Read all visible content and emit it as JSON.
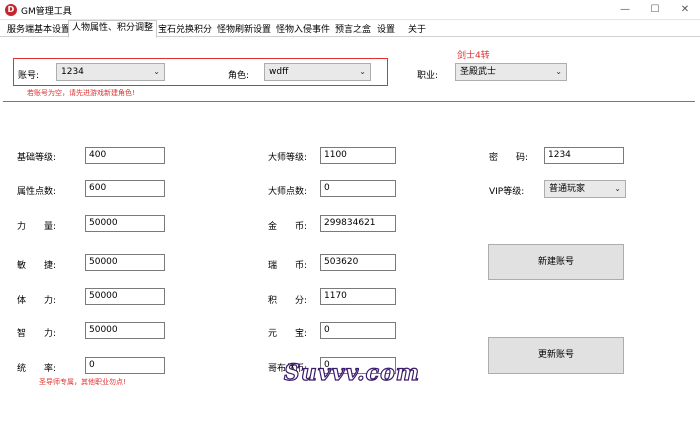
{
  "window": {
    "title": "GM管理工具",
    "icon_letter": "D",
    "minimize": "—",
    "maximize": "☐",
    "close": "✕"
  },
  "tabs": [
    "服务端基本设置",
    "人物属性、积分调整",
    "宝石兑换积分",
    "怪物刷新设置",
    "怪物入侵事件",
    "预言之盒",
    "设置",
    "关于"
  ],
  "account": {
    "label": "账号:",
    "value": "1234",
    "warning": "若账号为空，请先进游戏新建角色!",
    "role_label": "角色:",
    "role_value": "wdff",
    "job_label": "职业:",
    "job_value": "圣殿武士",
    "rank_text": "剑士4转"
  },
  "left": [
    {
      "label": "基础等级:",
      "value": "400"
    },
    {
      "label": "属性点数:",
      "value": "600"
    },
    {
      "label": "力　　量:",
      "value": "50000"
    },
    {
      "label": "敏　　捷:",
      "value": "50000"
    },
    {
      "label": "体　　力:",
      "value": "50000"
    },
    {
      "label": "智　　力:",
      "value": "50000"
    },
    {
      "label": "统　　率:",
      "value": "0"
    }
  ],
  "left_note": "圣导师专属，其他职业勿点!",
  "middle": [
    {
      "label": "大师等级:",
      "value": "1100"
    },
    {
      "label": "大师点数:",
      "value": "0"
    },
    {
      "label": "金　　币:",
      "value": "299834621"
    },
    {
      "label": "瑞　　币:",
      "value": "503620"
    },
    {
      "label": "积　　分:",
      "value": "1170"
    },
    {
      "label": "元　　宝:",
      "value": "0"
    },
    {
      "label": "哥布林币:",
      "value": "0"
    }
  ],
  "right": {
    "password_label": "密　　码:",
    "password_value": "1234",
    "vip_label": "VIP等级:",
    "vip_value": "普通玩家",
    "new_account_button": "新建账号",
    "update_account_button": "更新账号"
  },
  "watermark": "Suvvv.com",
  "colors": {
    "warning": "#e03030",
    "accent": "#c4262e"
  }
}
